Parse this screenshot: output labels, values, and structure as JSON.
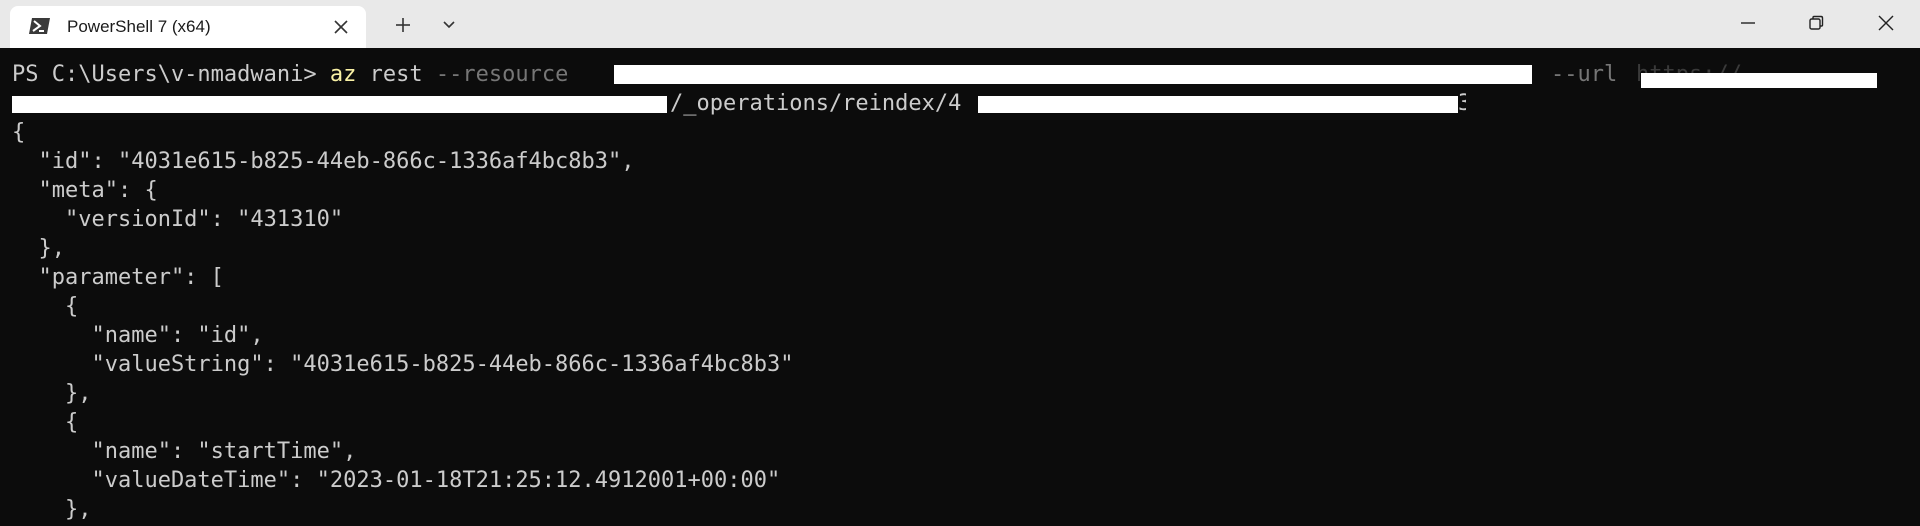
{
  "titlebar": {
    "tab_title": "PowerShell 7 (x64)",
    "tab_icon": "powershell-icon",
    "close_tab_icon": "close-icon",
    "new_tab_icon": "plus-icon",
    "dropdown_icon": "chevron-down-icon",
    "minimize_icon": "minimize-icon",
    "maximize_icon": "maximize-icon",
    "close_window_icon": "close-icon"
  },
  "terminal": {
    "prompt": "PS C:\\Users\\v-nmadwani> ",
    "command": "az",
    "subcommand": " rest ",
    "resource_flag": "--resource",
    "url_flag": "--url",
    "url_visible_fragment": "https://",
    "path_fragment": "/_operations/reindex/4",
    "path_end": "3",
    "output_lines": [
      "{",
      "  \"id\": \"4031e615-b825-44eb-866c-1336af4bc8b3\",",
      "  \"meta\": {",
      "    \"versionId\": \"431310\"",
      "  },",
      "  \"parameter\": [",
      "    {",
      "      \"name\": \"id\",",
      "      \"valueString\": \"4031e615-b825-44eb-866c-1336af4bc8b3\"",
      "    },",
      "    {",
      "      \"name\": \"startTime\",",
      "      \"valueDateTime\": \"2023-01-18T21:25:12.4912001+00:00\"",
      "    },"
    ]
  },
  "colors": {
    "background": "#0c0c0c",
    "foreground": "#cccccc",
    "command": "#f9f1a5",
    "parameter": "#767676",
    "titlebar": "#e9e9e9",
    "tab": "#ffffff"
  }
}
